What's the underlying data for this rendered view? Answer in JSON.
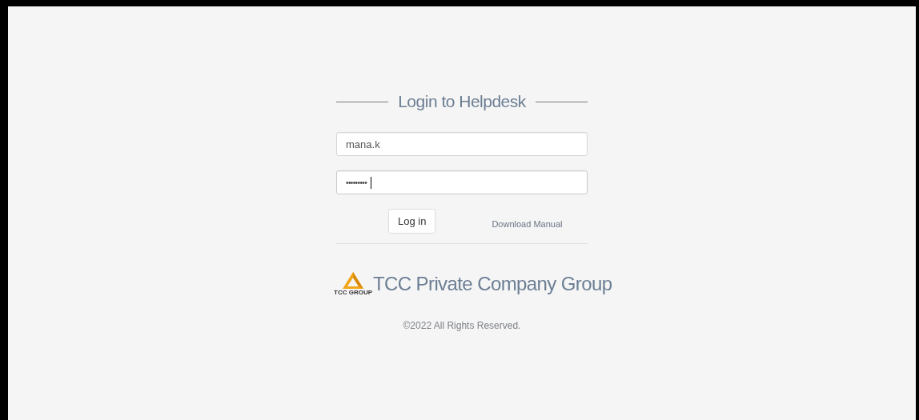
{
  "title": "Login to Helpdesk",
  "username": {
    "value": "mana.k"
  },
  "password": {
    "value": "•••••••••",
    "focused": true
  },
  "login_button": "Log in",
  "manual_link": "Download Manual",
  "logo": {
    "caption": "TCC GROUP",
    "company": "TCC Private Company Group"
  },
  "copyright": "©2022 All Rights Reserved."
}
